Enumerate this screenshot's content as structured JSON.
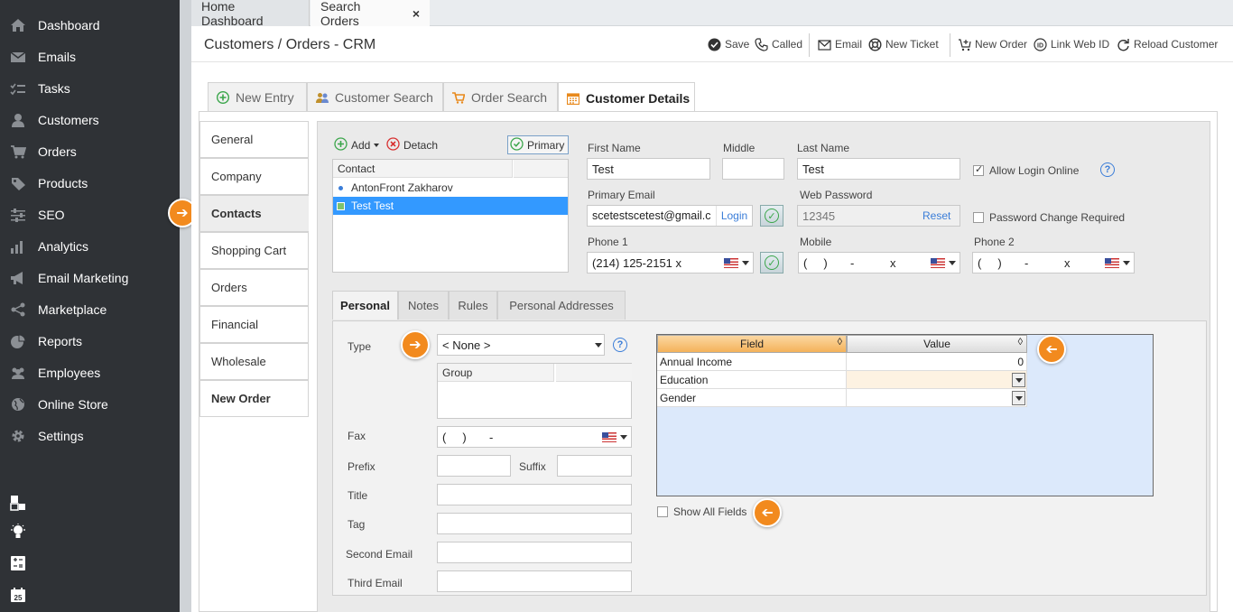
{
  "sidebar": {
    "items": [
      {
        "label": "Dashboard",
        "icon": "home-icon"
      },
      {
        "label": "Emails",
        "icon": "envelope-icon"
      },
      {
        "label": "Tasks",
        "icon": "tasks-icon"
      },
      {
        "label": "Customers",
        "icon": "user-icon"
      },
      {
        "label": "Orders",
        "icon": "cart-icon"
      },
      {
        "label": "Products",
        "icon": "tag-icon"
      },
      {
        "label": "SEO",
        "icon": "sliders-icon"
      },
      {
        "label": "Analytics",
        "icon": "bar-chart-icon"
      },
      {
        "label": "Email Marketing",
        "icon": "megaphone-icon"
      },
      {
        "label": "Marketplace",
        "icon": "share-icon"
      },
      {
        "label": "Reports",
        "icon": "pie-chart-icon"
      },
      {
        "label": "Employees",
        "icon": "users-icon"
      },
      {
        "label": "Online Store",
        "icon": "globe-icon"
      },
      {
        "label": "Settings",
        "icon": "gear-icon"
      }
    ],
    "bottom_icons": [
      "widgets-icon",
      "lightbulb-icon",
      "calculator-icon",
      "calendar-icon"
    ],
    "calendar_day": "25"
  },
  "top_tabs": {
    "home": "Home Dashboard",
    "search": "Search Orders",
    "close": "×"
  },
  "header": {
    "title": "Customers / Orders - CRM",
    "save": "Save",
    "called": "Called",
    "email": "Email",
    "new_ticket": "New Ticket",
    "new_order": "New Order",
    "link_web_id": "Link Web ID",
    "reload_customer": "Reload Customer"
  },
  "sub_tabs": {
    "new_entry": "New Entry",
    "customer_search": "Customer Search",
    "order_search": "Order Search",
    "customer_details": "Customer Details"
  },
  "section_menu": [
    "General",
    "Company",
    "Contacts",
    "Shopping Cart",
    "Orders",
    "Financial",
    "Wholesale",
    "New Order"
  ],
  "contacts": {
    "add": "Add",
    "detach": "Detach",
    "primary": "Primary",
    "column": "Contact",
    "rows": [
      "AntonFront Zakharov",
      "Test Test"
    ]
  },
  "form": {
    "first_name_label": "First Name",
    "first_name": "Test",
    "middle_label": "Middle",
    "middle": "",
    "last_name_label": "Last Name",
    "last_name": "Test",
    "allow_login_label": "Allow Login Online",
    "primary_email_label": "Primary Email",
    "primary_email": "scetestscetest@gmail.c",
    "login_link": "Login",
    "web_password_label": "Web Password",
    "web_password": "12345",
    "reset_link": "Reset",
    "password_change_label": "Password Change Required",
    "phone1_label": "Phone 1",
    "phone1": "(214) 125-2151 x",
    "mobile_label": "Mobile",
    "mobile": "(     )       -           x",
    "phone2_label": "Phone 2",
    "phone2": "(     )       -           x"
  },
  "inner_tabs": [
    "Personal",
    "Notes",
    "Rules",
    "Personal Addresses"
  ],
  "personal": {
    "type_label": "Type",
    "type_value": "< None >",
    "group_column": "Group",
    "fax_label": "Fax",
    "fax_value": "(     )       -",
    "prefix_label": "Prefix",
    "suffix_label": "Suffix",
    "title_label": "Title",
    "tag_label": "Tag",
    "second_email_label": "Second Email",
    "third_email_label": "Third Email"
  },
  "fields_grid": {
    "field_header": "Field",
    "value_header": "Value",
    "rows": [
      {
        "field": "Annual Income",
        "value": "0"
      },
      {
        "field": "Education",
        "value": ""
      },
      {
        "field": "Gender",
        "value": ""
      }
    ],
    "show_all_label": "Show All Fields"
  },
  "colors": {
    "sidebar_bg": "#2f3236",
    "accent_orange": "#f28a1e",
    "selection_blue": "#3399ff",
    "grid_bg": "#dce9fb"
  }
}
